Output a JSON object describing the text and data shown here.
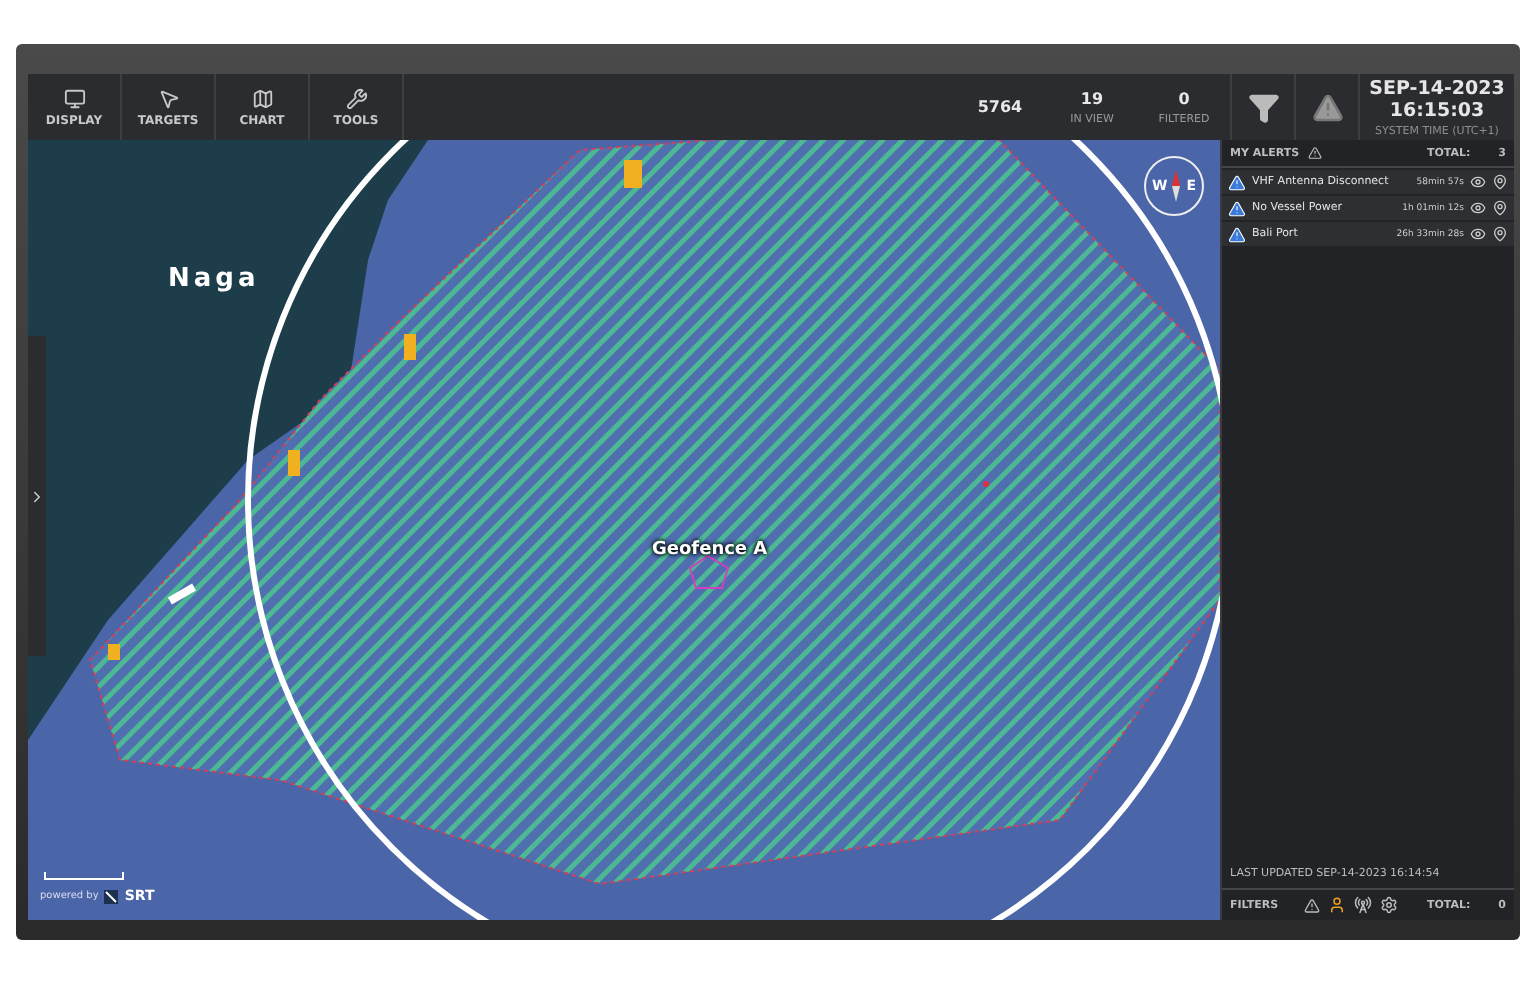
{
  "toolbar": {
    "tools": [
      {
        "kind": "monitor",
        "label": "DISPLAY"
      },
      {
        "kind": "cursor",
        "label": "TARGETS"
      },
      {
        "kind": "chart",
        "label": "CHART"
      },
      {
        "kind": "wrench",
        "label": "TOOLS"
      }
    ],
    "stats": [
      {
        "value": "5764"
      },
      {
        "value": "19",
        "label": "IN VIEW"
      },
      {
        "value": "0",
        "label": "FILTERED"
      }
    ],
    "date": "SEP-14-2023",
    "time": "16:15:03",
    "time_label": "SYSTEM TIME (UTC+1)"
  },
  "map": {
    "place_label": "Naga",
    "geofence_label": "Geofence A",
    "compass": {
      "west": "W",
      "east": "E"
    },
    "credit": "powered by",
    "brand": "SRT"
  },
  "alerts": {
    "title": "MY ALERTS",
    "total_label": "TOTAL:",
    "total": "3",
    "items": [
      {
        "name": "VHF Antenna Disconnect",
        "elapsed": "58min 57s"
      },
      {
        "name": "No Vessel Power",
        "elapsed": "1h 01min 12s"
      },
      {
        "name": "Bali Port",
        "elapsed": "26h 33min 28s"
      }
    ],
    "last_updated": "LAST UPDATED SEP-14-2023 16:14:54"
  },
  "filters": {
    "label": "FILTERS",
    "items": [
      {
        "kind": "warning",
        "selected": false
      },
      {
        "kind": "person",
        "selected": true
      },
      {
        "kind": "antenna",
        "selected": false
      },
      {
        "kind": "gear",
        "selected": false
      }
    ],
    "total_label": "TOTAL:",
    "total": "0"
  }
}
